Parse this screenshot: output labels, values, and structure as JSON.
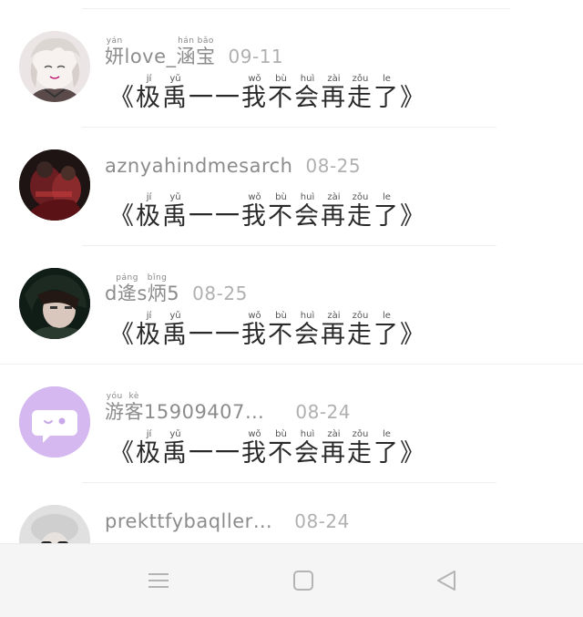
{
  "posts": [
    {
      "avatar_icon": "anime-character-avatar",
      "name_parts": [
        {
          "text": "妍",
          "pinyin": "yán"
        },
        {
          "text": "love_"
        },
        {
          "text": "涵",
          "pinyin": "hán"
        },
        {
          "text": "宝",
          "pinyin": "bǎo"
        }
      ],
      "date": "09-11",
      "title_parts": [
        {
          "text": "《"
        },
        {
          "text": "极",
          "pinyin": "jí"
        },
        {
          "text": "禹",
          "pinyin": "yǔ"
        },
        {
          "text": "一一"
        },
        {
          "text": "我",
          "pinyin": "wǒ"
        },
        {
          "text": "不",
          "pinyin": "bù"
        },
        {
          "text": "会",
          "pinyin": "huì"
        },
        {
          "text": "再",
          "pinyin": "zài"
        },
        {
          "text": "走",
          "pinyin": "zǒu"
        },
        {
          "text": "了",
          "pinyin": "le"
        },
        {
          "text": "》"
        }
      ]
    },
    {
      "avatar_icon": "photo-avatar-dark",
      "name_parts": [
        {
          "text": "aznyahindmesarch"
        }
      ],
      "date": "08-25",
      "title_parts": [
        {
          "text": "《"
        },
        {
          "text": "极",
          "pinyin": "jí"
        },
        {
          "text": "禹",
          "pinyin": "yǔ"
        },
        {
          "text": "一一"
        },
        {
          "text": "我",
          "pinyin": "wǒ"
        },
        {
          "text": "不",
          "pinyin": "bù"
        },
        {
          "text": "会",
          "pinyin": "huì"
        },
        {
          "text": "再",
          "pinyin": "zài"
        },
        {
          "text": "走",
          "pinyin": "zǒu"
        },
        {
          "text": "了",
          "pinyin": "le"
        },
        {
          "text": "》"
        }
      ]
    },
    {
      "avatar_icon": "photo-avatar-person",
      "name_parts": [
        {
          "text": "d"
        },
        {
          "text": "逄",
          "pinyin": "páng"
        },
        {
          "text": "s"
        },
        {
          "text": "炳",
          "pinyin": "bǐng"
        },
        {
          "text": "5"
        }
      ],
      "date": "08-25",
      "title_parts": [
        {
          "text": "《"
        },
        {
          "text": "极",
          "pinyin": "jí"
        },
        {
          "text": "禹",
          "pinyin": "yǔ"
        },
        {
          "text": "一一"
        },
        {
          "text": "我",
          "pinyin": "wǒ"
        },
        {
          "text": "不",
          "pinyin": "bù"
        },
        {
          "text": "会",
          "pinyin": "huì"
        },
        {
          "text": "再",
          "pinyin": "zài"
        },
        {
          "text": "走",
          "pinyin": "zǒu"
        },
        {
          "text": "了",
          "pinyin": "le"
        },
        {
          "text": "》"
        }
      ]
    },
    {
      "avatar_icon": "chat-bubble-icon",
      "name_parts": [
        {
          "text": "游",
          "pinyin": "yóu"
        },
        {
          "text": "客",
          "pinyin": "kè"
        },
        {
          "text": "15909407…"
        }
      ],
      "date": "08-24",
      "title_parts": [
        {
          "text": "《"
        },
        {
          "text": "极",
          "pinyin": "jí"
        },
        {
          "text": "禹",
          "pinyin": "yǔ"
        },
        {
          "text": "一一"
        },
        {
          "text": "我",
          "pinyin": "wǒ"
        },
        {
          "text": "不",
          "pinyin": "bù"
        },
        {
          "text": "会",
          "pinyin": "huì"
        },
        {
          "text": "再",
          "pinyin": "zài"
        },
        {
          "text": "走",
          "pinyin": "zǒu"
        },
        {
          "text": "了",
          "pinyin": "le"
        },
        {
          "text": "》"
        }
      ]
    },
    {
      "avatar_icon": "photo-avatar-hat",
      "name_parts": [
        {
          "text": "prekttfybaqller…"
        }
      ],
      "date": "08-24",
      "title_parts": []
    }
  ],
  "nav": {
    "menu_icon": "menu-icon",
    "home_icon": "home-square-icon",
    "back_icon": "back-triangle-icon"
  },
  "colors": {
    "chat_avatar_bg": "#d4b8ef",
    "name_text": "#8c8c8c",
    "date_text": "#b0b0b0",
    "title_text": "#2a2a2a",
    "nav_bar_bg": "#f5f5f5"
  }
}
